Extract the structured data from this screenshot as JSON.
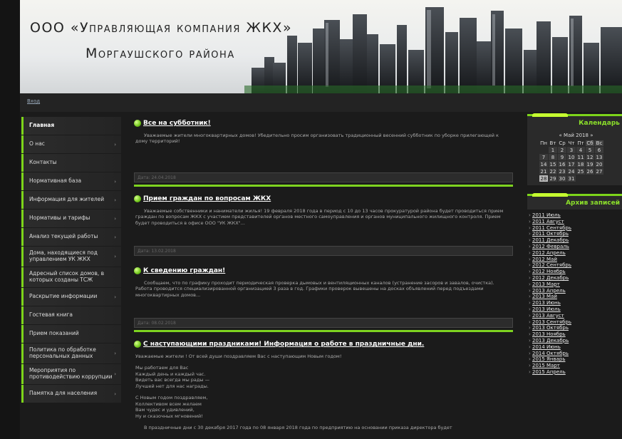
{
  "header": {
    "title_line1": "ООО «Управляющая компания ЖКХ»",
    "title_line2": "Моргаушского района"
  },
  "topbar": {
    "login": "Вход"
  },
  "menu": [
    {
      "label": "Главная",
      "active": true,
      "arrow": false
    },
    {
      "label": "О нас",
      "arrow": true
    },
    {
      "label": "Контакты",
      "arrow": false
    },
    {
      "label": "Нормативная база",
      "arrow": true
    },
    {
      "label": "Информация для жителей",
      "arrow": true
    },
    {
      "label": "Нормативы и тарифы",
      "arrow": true
    },
    {
      "label": "Анализ текущей работы",
      "arrow": true
    },
    {
      "label": "Дома, находящиеся под управлением УК ЖКХ",
      "arrow": true
    },
    {
      "label": "Адресный список домов, в которых созданы ТСЖ",
      "arrow": false
    },
    {
      "label": "Раскрытие информации",
      "arrow": true
    },
    {
      "label": "Гостевая книга",
      "arrow": false
    },
    {
      "label": "Прием показаний",
      "arrow": false
    },
    {
      "label": "Политика по обработке персональных данных",
      "arrow": true
    },
    {
      "label": "Мероприятия по противодействию коррупции",
      "arrow": true
    },
    {
      "label": "Памятка для населения",
      "arrow": true
    }
  ],
  "posts": [
    {
      "title": "Все на субботник!",
      "body": "Уважаемые жители многоквартирных домов! Убедительно просим организовать традиционный весенний субботник по уборке прилегающей к дому территорий!",
      "date": "Дата: 24.04.2018"
    },
    {
      "title": "Прием граждан по вопросам ЖКХ",
      "body": "Уважаемые собственники и наниматели жилья! 19 февраля 2018 года в период с 10 до 13 часов прокуратурой района будет проводиться прием граждан по вопросам ЖКХ с участием представителей органов местного самоуправления и органов муниципального жилищного контроля. Прием будет проводиться в офисе ООО \"УК ЖКХ\"...",
      "date": "Дата: 13.02.2018"
    },
    {
      "title": "К сведению граждан!",
      "body": "Сообщаем, что по графику проходит периодическая проверка дымовых и вентиляционных каналов (устранение засоров и завалов, очистка). Работа проводится  специализированной организацией 3 раза в год. Графики проверок вывешены на досках объявлений перед подъездами многоквартирных домов...",
      "date": "Дата: 08.02.2018"
    },
    {
      "title": "С наступающими праздниками! Информация о работе в праздничные дни.",
      "body_lines": [
        "Уважаемые жители ! От всей души поздравляем Вас с наступающим Новым годом!",
        "",
        "Мы работаем для Вас",
        "Каждый день и каждый час.",
        "Видеть вас всегда мы рады —",
        "Лучшей нет для нас награды.",
        "",
        "С Новым годом поздравляем,",
        "Коллективом всем желаем",
        "Вам чудес и удивлений,",
        "Ну и сказочных мгновений!",
        "",
        "В праздничные дни с 30 декабря 2017 года по 08 января 2018 года по предприятию на основании приказа директора будет"
      ]
    }
  ],
  "calendar": {
    "heading": "Календарь",
    "month": "Май 2018",
    "prev": "«",
    "next": "»",
    "weekdays": [
      "Пн",
      "Вт",
      "Ср",
      "Чт",
      "Пт",
      "Сб",
      "Вс"
    ],
    "weeks": [
      [
        "",
        "1",
        "2",
        "3",
        "4",
        "5",
        "6"
      ],
      [
        "7",
        "8",
        "9",
        "10",
        "11",
        "12",
        "13"
      ],
      [
        "14",
        "15",
        "16",
        "17",
        "18",
        "19",
        "20"
      ],
      [
        "21",
        "22",
        "23",
        "24",
        "25",
        "26",
        "27"
      ],
      [
        "28",
        "29",
        "30",
        "31",
        "",
        "",
        ""
      ]
    ],
    "today": "28"
  },
  "archive": {
    "heading": "Архив записей",
    "items": [
      "2011 Июль",
      "2011 Август",
      "2011 Сентябрь",
      "2011 Октябрь",
      "2011 Декабрь",
      "2012 Февраль",
      "2012 Апрель",
      "2012 Май",
      "2012 Сентябрь",
      "2012 Ноябрь",
      "2012 Декабрь",
      "2013 Март",
      "2013 Апрель",
      "2013 Май",
      "2013 Июнь",
      "2013 Июль",
      "2013 Август",
      "2013 Сентябрь",
      "2013 Октябрь",
      "2013 Ноябрь",
      "2013 Декабрь",
      "2014 Июнь",
      "2014 Октябрь",
      "2015 Январь",
      "2015 Март",
      "2015 Апрель"
    ]
  },
  "colors": {
    "accent": "#7dd51a",
    "background": "#1b1b1b"
  }
}
